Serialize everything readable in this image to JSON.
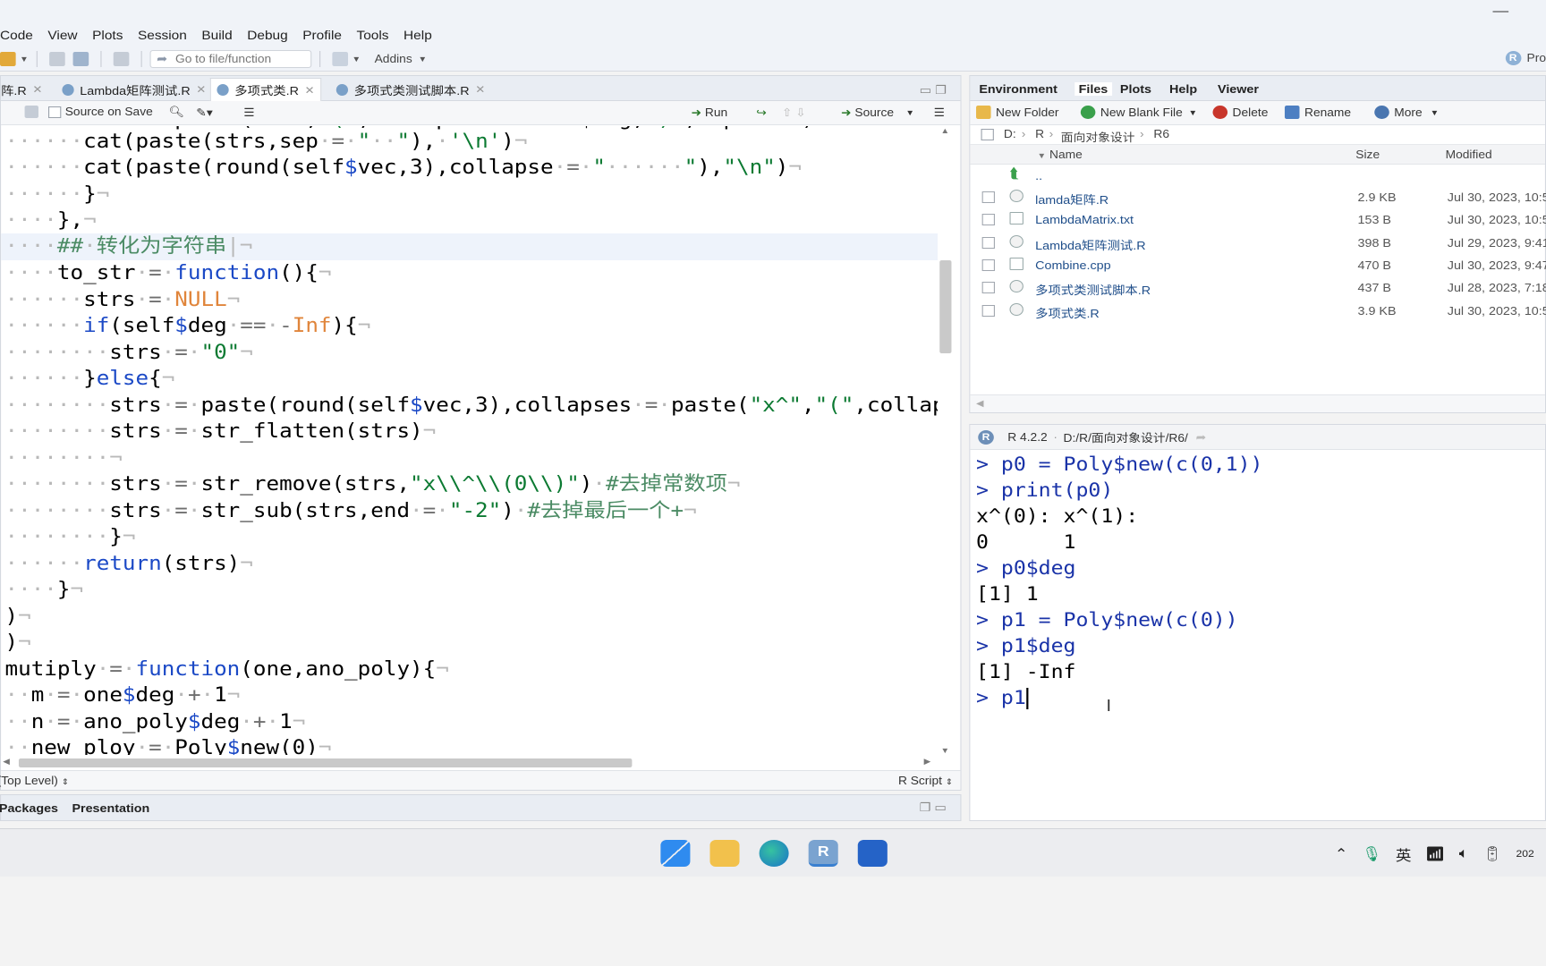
{
  "menu": [
    "Code",
    "View",
    "Plots",
    "Session",
    "Build",
    "Debug",
    "Profile",
    "Tools",
    "Help"
  ],
  "toolbar": {
    "goto_placeholder": "Go to file/function",
    "addins": "Addins",
    "project": "Pro"
  },
  "editor": {
    "tabs": [
      {
        "label": "阵.R"
      },
      {
        "label": "Lambda矩阵测试.R"
      },
      {
        "label": "多项式类.R"
      },
      {
        "label": "多项式类测试脚本.R"
      }
    ],
    "source_on_save": "Source on Save",
    "run": "Run",
    "source": "Source",
    "status_scope": "(Top Level)",
    "status_type": "R Script"
  },
  "bottom_left_tabs": [
    "Packages",
    "Presentation"
  ],
  "files": {
    "tabs": [
      "Environment",
      "Files",
      "Plots",
      "Help",
      "Viewer"
    ],
    "toolbar": {
      "new_folder": "New Folder",
      "new_blank_file": "New Blank File",
      "delete": "Delete",
      "rename": "Rename",
      "more": "More"
    },
    "breadcrumb": [
      "D:",
      "R",
      "面向对象设计",
      "R6"
    ],
    "columns": {
      "name": "Name",
      "size": "Size",
      "modified": "Modified"
    },
    "parent": "..",
    "rows": [
      {
        "name": "lamda矩阵.R",
        "size": "2.9 KB",
        "modified": "Jul 30, 2023, 10:5"
      },
      {
        "name": "LambdaMatrix.txt",
        "size": "153 B",
        "modified": "Jul 30, 2023, 10:5"
      },
      {
        "name": "Lambda矩阵测试.R",
        "size": "398 B",
        "modified": "Jul 29, 2023, 9:41"
      },
      {
        "name": "Combine.cpp",
        "size": "470 B",
        "modified": "Jul 30, 2023, 9:47"
      },
      {
        "name": "多项式类测试脚本.R",
        "size": "437 B",
        "modified": "Jul 28, 2023, 7:18"
      },
      {
        "name": "多项式类.R",
        "size": "3.9 KB",
        "modified": "Jul 30, 2023, 10:5"
      }
    ]
  },
  "console": {
    "version": "R 4.2.2",
    "path": "D:/R/面向对象设计/R6/",
    "lines": [
      {
        "kind": "in",
        "text": "> p0 = Poly$new(c(0,1))"
      },
      {
        "kind": "in",
        "text": "> print(p0)"
      },
      {
        "kind": "out",
        "text": "x^(0): x^(1):"
      },
      {
        "kind": "out",
        "text": "0      1"
      },
      {
        "kind": "in",
        "text": "> p0$deg"
      },
      {
        "kind": "out",
        "text": "[1] 1"
      },
      {
        "kind": "in",
        "text": "> p1 = Poly$new(c(0))"
      },
      {
        "kind": "in",
        "text": "> p1$deg"
      },
      {
        "kind": "out",
        "text": "[1] -Inf"
      },
      {
        "kind": "in",
        "text": "> p1"
      }
    ]
  },
  "taskbar": {
    "ime": "英",
    "clock": "202"
  },
  "colors": {
    "keyword": "#1b49c6",
    "string": "#0c7a32",
    "number": "#e0853b",
    "console_input": "#1a33a8"
  }
}
